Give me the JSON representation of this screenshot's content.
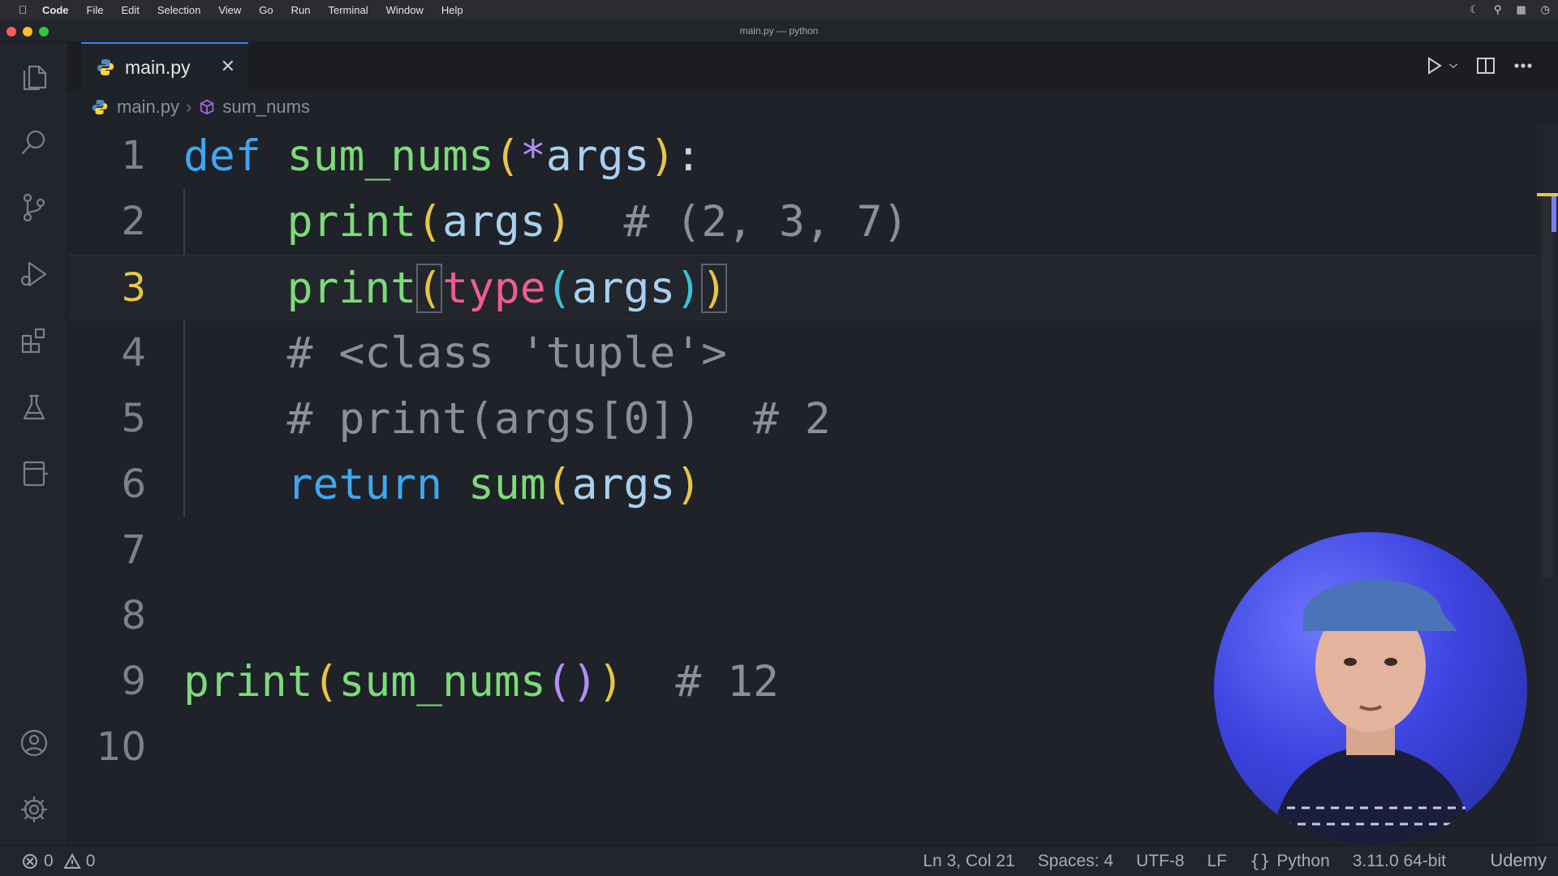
{
  "menubar": {
    "app": "Code",
    "items": [
      "File",
      "Edit",
      "Selection",
      "View",
      "Go",
      "Run",
      "Terminal",
      "Window",
      "Help"
    ]
  },
  "window": {
    "title": "main.py — python"
  },
  "tab": {
    "label": "main.py",
    "close_glyph": "✕"
  },
  "breadcrumb": {
    "file": "main.py",
    "symbol": "sum_nums",
    "separator": "›"
  },
  "editor": {
    "current_line": 3,
    "lines": [
      {
        "n": "1",
        "text": "def sum_nums(*args):"
      },
      {
        "n": "2",
        "text": "    print(args)  # (2, 3, 7)"
      },
      {
        "n": "3",
        "text": "    print(type(args))"
      },
      {
        "n": "4",
        "text": "    # <class 'tuple'>"
      },
      {
        "n": "5",
        "text": "    # print(args[0])  # 2"
      },
      {
        "n": "6",
        "text": "    return sum(args)"
      },
      {
        "n": "7",
        "text": ""
      },
      {
        "n": "8",
        "text": ""
      },
      {
        "n": "9",
        "text": "print(sum_nums())  # 12"
      },
      {
        "n": "10",
        "text": ""
      }
    ]
  },
  "statusbar": {
    "errors": "0",
    "warnings": "0",
    "position": "Ln 3, Col 21",
    "spaces": "Spaces: 4",
    "encoding": "UTF-8",
    "eol": "LF",
    "language": "Python",
    "interpreter": "3.11.0 64-bit"
  },
  "watermark": "Udemy",
  "colors": {
    "editor_bg": "#1f2229",
    "keyword": "#3fa7f0",
    "function": "#7ddb7a",
    "variable": "#a9d0ee",
    "builtin": "#ef5d8c",
    "comment": "#8a8f98",
    "active_line_number": "#e8c547",
    "webcam_bg": "#3d44e0"
  }
}
